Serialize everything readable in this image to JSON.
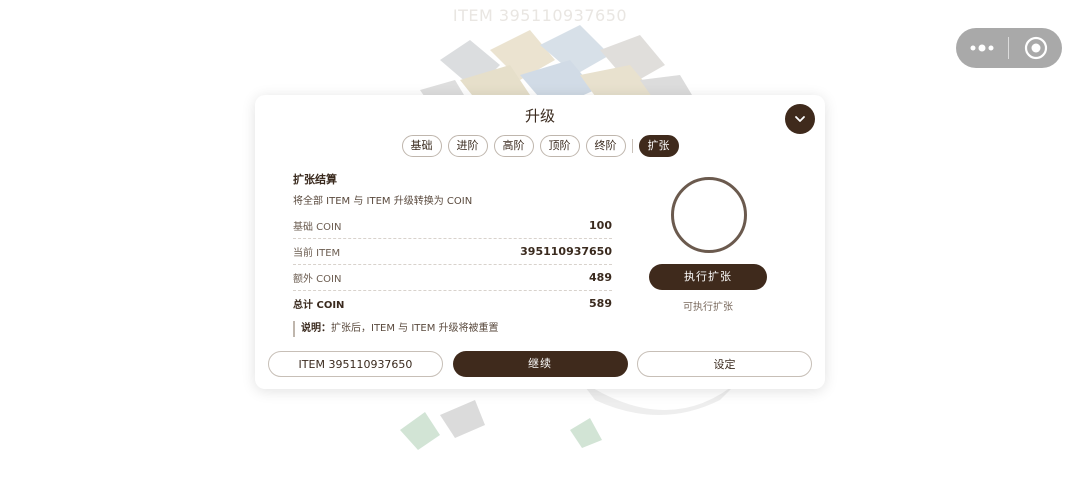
{
  "background": {
    "title": "ITEM 395110937650"
  },
  "capsule": {
    "more_icon": "more-dots-icon",
    "close_icon": "target-close-icon"
  },
  "panel": {
    "title": "升级",
    "collapse_icon": "chevron-down-icon",
    "tabs": [
      {
        "label": "基础",
        "active": false
      },
      {
        "label": "进阶",
        "active": false
      },
      {
        "label": "高阶",
        "active": false
      },
      {
        "label": "顶阶",
        "active": false
      },
      {
        "label": "终阶",
        "active": false
      },
      {
        "label": "扩张",
        "active": true
      }
    ],
    "section_title": "扩张结算",
    "section_desc": "将全部 ITEM 与 ITEM 升级转换为 COIN",
    "rows": [
      {
        "label": "基础 COIN",
        "value": "100"
      },
      {
        "label": "当前 ITEM",
        "value": "395110937650"
      },
      {
        "label": "额外 COIN",
        "value": "489"
      },
      {
        "label": "总计 COIN",
        "value": "589"
      }
    ],
    "note_label": "说明：",
    "note_text": "扩张后，ITEM 与 ITEM 升级将被重置",
    "exec_button": "执行扩张",
    "exec_hint": "可执行扩张",
    "bottom": {
      "item_button": "ITEM 395110937650",
      "continue_button": "继续",
      "settings_button": "设定"
    }
  },
  "colors": {
    "primary": "#3f2a1c",
    "text": "#3a2a1e",
    "border": "#c7bfb7",
    "capsule": "#a9a9a9"
  }
}
